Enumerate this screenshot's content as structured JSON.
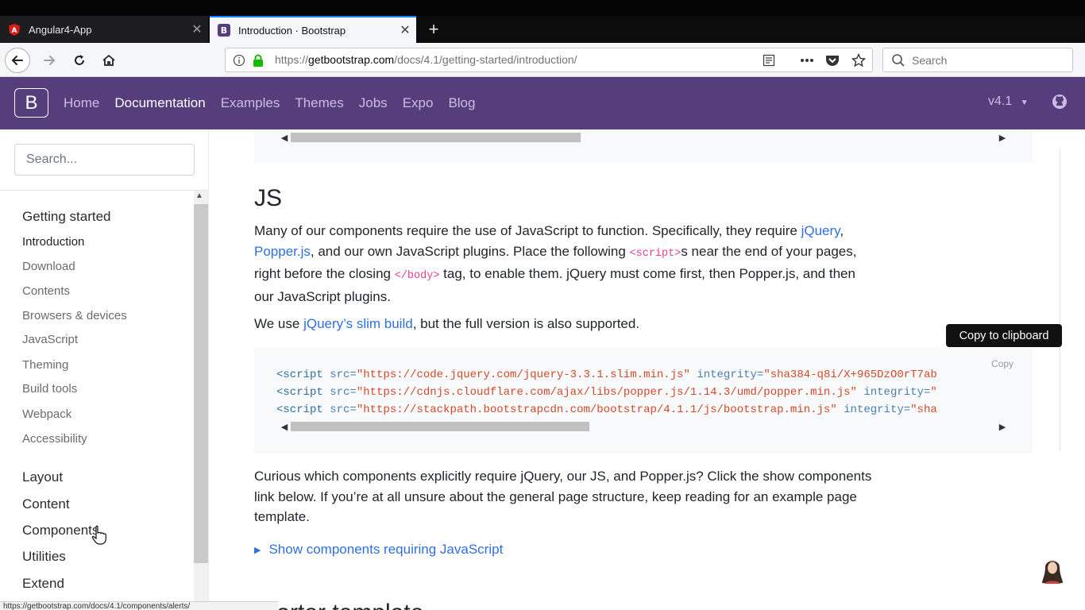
{
  "browser": {
    "tabs": [
      {
        "title": "Angular4-App",
        "active": false,
        "icon": "angular-icon"
      },
      {
        "title": "Introduction · Bootstrap",
        "active": true,
        "icon": "bootstrap-icon"
      }
    ],
    "url_prefix": "https://",
    "url_domain": "getbootstrap.com",
    "url_path": "/docs/4.1/getting-started/introduction/",
    "search_placeholder": "Search",
    "status_url": "https://getbootstrap.com/docs/4.1/components/alerts/"
  },
  "nav": {
    "brand": "B",
    "links": [
      "Home",
      "Documentation",
      "Examples",
      "Themes",
      "Jobs",
      "Expo",
      "Blog"
    ],
    "active_link": "Documentation",
    "version": "v4.1",
    "colors": {
      "bg": "#563d7c",
      "link": "#cbbde2",
      "active": "#ffffff"
    }
  },
  "sidebar": {
    "search_placeholder": "Search...",
    "group_getting_started": "Getting started",
    "items": [
      "Introduction",
      "Download",
      "Contents",
      "Browsers & devices",
      "JavaScript",
      "Theming",
      "Build tools",
      "Webpack",
      "Accessibility"
    ],
    "current_item": "Introduction",
    "groups": [
      "Layout",
      "Content",
      "Components",
      "Utilities",
      "Extend"
    ]
  },
  "content": {
    "heading": "JS",
    "p1_a": "Many of our components require the use of JavaScript to function. Specifically, they require",
    "p1_link1": "jQuery",
    "p1_comma": ", ",
    "p1_link2": "Popper.js",
    "p1_b": ", and our own JavaScript plugins. Place the following ",
    "p1_code1": "<script>",
    "p1_c": "s near the end of your pages, right before the closing ",
    "p1_code2": "</body>",
    "p1_d": " tag, to enable them. jQuery must come first, then Popper.js, and then our JavaScript plugins.",
    "p2_a": "We use ",
    "p2_link": "jQuery’s slim build",
    "p2_b": ", but the full version is also supported.",
    "tooltip": "Copy to clipboard",
    "copy_label": "Copy",
    "code_lines": [
      {
        "tag": "<script",
        "attr1": "src=",
        "str1": "\"https://code.jquery.com/jquery-3.3.1.slim.min.js\"",
        "attr2": "integrity=",
        "str2": "\"sha384-q8i/X+965DzO0rT7ab"
      },
      {
        "tag": "<script",
        "attr1": "src=",
        "str1": "\"https://cdnjs.cloudflare.com/ajax/libs/popper.js/1.14.3/umd/popper.min.js\"",
        "attr2": "integrity=",
        "str2": "\""
      },
      {
        "tag": "<script",
        "attr1": "src=",
        "str1": "\"https://stackpath.bootstrapcdn.com/bootstrap/4.1.1/js/bootstrap.min.js\"",
        "attr2": "integrity=",
        "str2": "\"sha"
      }
    ],
    "p3": "Curious which components explicitly require jQuery, our JS, and Popper.js? Click the show components link below. If you’re at all unsure about the general page structure, keep reading for an example page template.",
    "details_label": "Show components requiring JavaScript",
    "next_heading": "Starter template"
  }
}
